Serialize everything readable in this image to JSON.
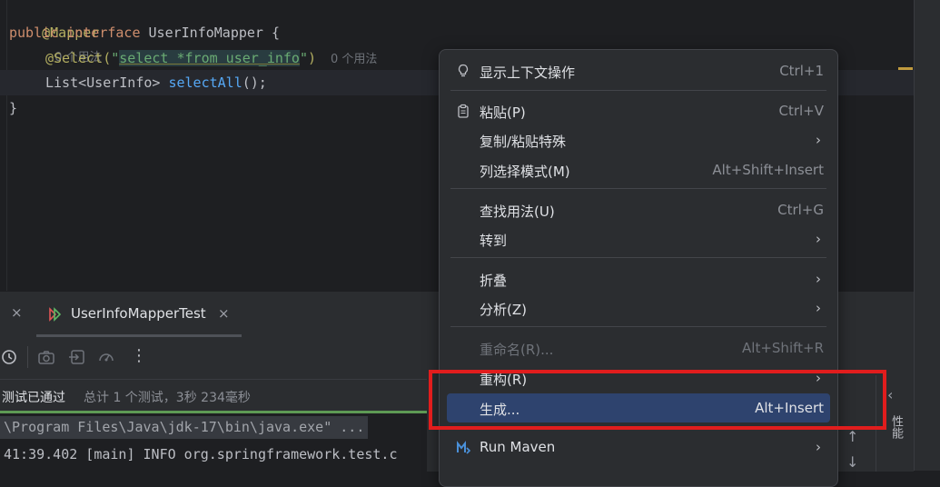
{
  "editor": {
    "mapper_annotation": "@Mapper",
    "mapper_hint": "0 个用法",
    "kw_public": "public",
    "kw_interface": "interface",
    "interface_name": "UserInfoMapper",
    "open_brace": "{",
    "select_annotation": "@Select(",
    "sql_quote_open": "\"",
    "sql_text": "select *from user_info",
    "sql_quote_close": "\"",
    "select_paren_close": ")",
    "select_hint": "0 个用法",
    "method_type": "List<UserInfo>",
    "method_name": "selectAll",
    "method_tail": "();",
    "close_brace": "}"
  },
  "tool_window": {
    "tab_label": "UserInfoMapperTest",
    "close_glyph": "×",
    "status_passed": "测试已通过",
    "status_summary": "总计 1 个测试，3秒 234毫秒",
    "console_lines": [
      "\\Program Files\\Java\\jdk-17\\bin\\java.exe\" ...",
      "41:39.402 [main] INFO org.springframework.test.c"
    ],
    "right_panel_label": "性能",
    "more_glyph": "⋮",
    "chevron_glyph": "‹",
    "up_glyph": "↑",
    "down_glyph": "↓"
  },
  "context_menu": {
    "items": [
      {
        "label": "显示上下文操作",
        "shortcut": "Ctrl+1",
        "icon": "bulb-icon"
      },
      {
        "label": "粘贴(P)",
        "shortcut": "Ctrl+V",
        "icon": "clipboard-icon"
      },
      {
        "label": "复制/粘贴特殊",
        "arrow": "›"
      },
      {
        "label": "列选择模式(M)",
        "shortcut": "Alt+Shift+Insert"
      },
      {
        "label": "查找用法(U)",
        "shortcut": "Ctrl+G"
      },
      {
        "label": "转到",
        "arrow": "›"
      },
      {
        "label": "折叠",
        "arrow": "›"
      },
      {
        "label": "分析(Z)",
        "arrow": "›"
      },
      {
        "label": "重命名(R)...",
        "shortcut": "Alt+Shift+R",
        "disabled": true
      },
      {
        "label": "重构(R)",
        "arrow": "›"
      },
      {
        "label": "生成...",
        "shortcut": "Alt+Insert",
        "selected": true
      },
      {
        "label": "Run Maven",
        "arrow": "›",
        "icon": "maven-icon"
      }
    ]
  },
  "colors": {
    "accent_selected": "#2e436e",
    "highlight_box": "#e11d1d",
    "annotation": "#b3ae60",
    "keyword": "#cf8e6d",
    "string": "#6aab73",
    "function": "#56a8f5"
  }
}
